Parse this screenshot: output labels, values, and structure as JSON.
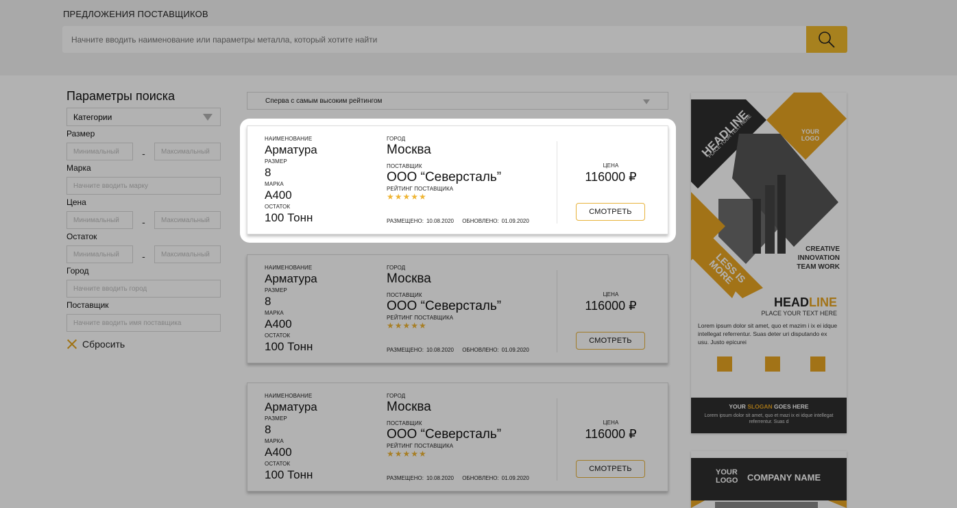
{
  "header": {
    "title": "ПРЕДЛОЖЕНИЯ ПОСТАВЩИКОВ",
    "search_placeholder": "Начните вводить наименование или параметры металла, который хотите найти",
    "search_icon": "search-icon"
  },
  "filters": {
    "title": "Параметры поиска",
    "category": "Категории",
    "size_label": "Размер",
    "min_placeholder": "Минимальный",
    "max_placeholder": "Максимальный",
    "dash": "-",
    "brand_label": "Марка",
    "brand_placeholder": "Начните вводить марку",
    "price_label": "Цена",
    "stock_label": "Остаток",
    "city_label": "Город",
    "city_placeholder": "Начните вводить город",
    "supplier_label": "Поставщик",
    "supplier_placeholder": "Начните вводить имя поставщика",
    "reset_label": "Сбросить"
  },
  "sort": {
    "selected": "Сперва с самым высоким рейтингом"
  },
  "labels": {
    "name": "НАИМЕНОВАНИЕ",
    "size": "РАЗМЕР",
    "brand": "МАРКА",
    "stock": "ОСТАТОК",
    "city": "ГОРОД",
    "supplier": "ПОСТАВЩИК",
    "rating": "РЕЙТИНГ ПОСТАВЩИКА",
    "placed": "РАЗМЕЩЕНО:",
    "updated": "ОБНОВЛЕНО:",
    "price": "ЦЕНА",
    "view": "СМОТРЕТЬ"
  },
  "offers": [
    {
      "name": "Арматура",
      "size": "8",
      "brand": "А400",
      "stock": "100 Тонн",
      "city": "Москва",
      "supplier": "ООО “Северсталь”",
      "rating": 5,
      "stars": "★★★★★",
      "placed": "10.08.2020",
      "updated": "01.09.2020",
      "price": "116000 ₽"
    },
    {
      "name": "Арматура",
      "size": "8",
      "brand": "А400",
      "stock": "100 Тонн",
      "city": "Москва",
      "supplier": "ООО “Северсталь”",
      "rating": 5,
      "stars": "★★★★★",
      "placed": "10.08.2020",
      "updated": "01.09.2020",
      "price": "116000 ₽"
    },
    {
      "name": "Арматура",
      "size": "8",
      "brand": "А400",
      "stock": "100 Тонн",
      "city": "Москва",
      "supplier": "ООО “Северсталь”",
      "rating": 5,
      "stars": "★★★★★",
      "placed": "10.08.2020",
      "updated": "01.09.2020",
      "price": "116000 ₽"
    }
  ],
  "ads": {
    "ad1": {
      "headline_diag": "HEADLINE",
      "place_text_diag": "PLACE YOUR TEXT HERE",
      "your_logo": "YOUR LOGO",
      "less_is_more": "LESS IS MORE",
      "creative": "CREATIVE",
      "innovation": "INNOVATION",
      "team_work": "TEAM WORK",
      "headline_a": "HEAD",
      "headline_b": "LINE",
      "place_text": "PLACE YOUR TEXT HERE",
      "lorem": "Lorem ipsum dolor sit amet, quo et mazim i ix ei idque intellegat referrentur. Suas deter uri disputando ex usu. Justo epicurei",
      "slogan_a": "YOUR ",
      "slogan_b": "SLOGAN",
      "slogan_c": " GOES HERE",
      "lorem2": "Lorem ipsum dolor sit amet, quo et mazi ix ei idque intellegat referrentur. Suas d"
    },
    "ad2": {
      "your_logo": "YOUR LOGO",
      "company": "COMPANY NAME"
    }
  },
  "colors": {
    "accent": "#f0b92c",
    "star": "#efb534",
    "button_border": "#e7b23b",
    "ad_dark": "#2f2f2f",
    "ad_yellow": "#e8a521"
  }
}
